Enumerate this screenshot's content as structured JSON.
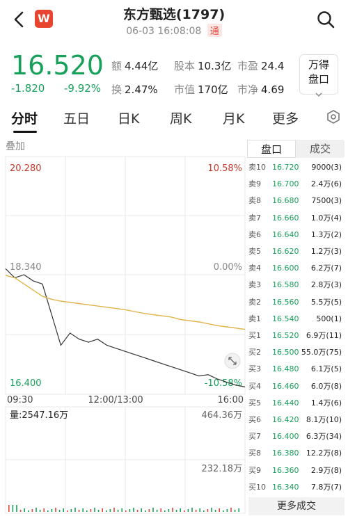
{
  "header": {
    "title": "东方甄选(1797)",
    "datetime": "06-03 16:08:08",
    "market_badge": "通",
    "logo_letter": "W"
  },
  "quote": {
    "price": "16.520",
    "change": "-1.820",
    "change_pct": "-9.92%",
    "stats": [
      {
        "k": "额",
        "v": "4.44亿"
      },
      {
        "k": "股本",
        "v": "10.3亿"
      },
      {
        "k": "市盈",
        "v": "24.4"
      },
      {
        "k": "换",
        "v": "2.47%"
      },
      {
        "k": "市值",
        "v": "170亿"
      },
      {
        "k": "市净",
        "v": "4.69"
      }
    ],
    "wan_label_1": "万得",
    "wan_label_2": "盘口"
  },
  "tabs": [
    "分时",
    "五日",
    "日K",
    "周K",
    "月K",
    "更多"
  ],
  "chart": {
    "overlay_label": "叠加",
    "high": "20.280",
    "high_pct": "10.58%",
    "mid": "18.340",
    "mid_pct": "0.00%",
    "low": "16.400",
    "low_pct": "-10.58%",
    "time_start": "09:30",
    "time_mid": "12:00/13:00",
    "time_end": "16:00",
    "volume_label": "量:2547.16万",
    "vol_max": "464.36万",
    "vol_mid": "232.18万",
    "colors": {
      "price_line": "#333333",
      "avg_line": "#e0b34a",
      "up": "#e4463a",
      "down": "#16a05a"
    }
  },
  "chart_data": {
    "type": "line",
    "title": "",
    "xlabel": "",
    "ylabel": "",
    "ylim": [
      16.4,
      20.28
    ],
    "x_ticks": [
      "09:30",
      "12:00/13:00",
      "16:00"
    ],
    "series": [
      {
        "values": [
          18.45,
          18.3,
          18.35,
          18.25,
          18.2,
          17.7,
          17.2,
          17.4,
          17.3,
          17.25,
          17.3,
          17.2,
          17.15,
          17.1,
          17.05,
          17.0,
          16.95,
          16.9,
          16.85,
          16.8,
          16.75,
          16.7,
          16.72,
          16.65,
          16.6,
          16.55,
          16.52
        ]
      },
      {
        "values": [
          18.34,
          18.3,
          18.2,
          18.1,
          18.0,
          17.95,
          17.92,
          17.9,
          17.88,
          17.86,
          17.84,
          17.82,
          17.8,
          17.78,
          17.75,
          17.72,
          17.7,
          17.68,
          17.66,
          17.62,
          17.6,
          17.58,
          17.55,
          17.52,
          17.5,
          17.48,
          17.46
        ]
      }
    ]
  },
  "order_book": {
    "tab_active": "盘口",
    "tab_other": "成交",
    "asks": [
      {
        "level": "卖10",
        "price": "16.720",
        "vol": "9000(3)"
      },
      {
        "level": "卖9",
        "price": "16.700",
        "vol": "2.4万(6)"
      },
      {
        "level": "卖8",
        "price": "16.680",
        "vol": "7500(3)"
      },
      {
        "level": "卖7",
        "price": "16.660",
        "vol": "1.0万(4)"
      },
      {
        "level": "卖6",
        "price": "16.640",
        "vol": "1.3万(2)"
      },
      {
        "level": "卖5",
        "price": "16.620",
        "vol": "1.2万(3)"
      },
      {
        "level": "卖4",
        "price": "16.600",
        "vol": "6.2万(7)"
      },
      {
        "level": "卖3",
        "price": "16.580",
        "vol": "2.8万(3)"
      },
      {
        "level": "卖2",
        "price": "16.560",
        "vol": "5.5万(5)"
      },
      {
        "level": "卖1",
        "price": "16.540",
        "vol": "500(1)"
      }
    ],
    "bids": [
      {
        "level": "买1",
        "price": "16.520",
        "vol": "6.9万(11)"
      },
      {
        "level": "买2",
        "price": "16.500",
        "vol": "55.0万(75)"
      },
      {
        "level": "买3",
        "price": "16.480",
        "vol": "6.1万(5)"
      },
      {
        "level": "买4",
        "price": "16.460",
        "vol": "6.0万(8)"
      },
      {
        "level": "买5",
        "price": "16.440",
        "vol": "1.4万(6)"
      },
      {
        "level": "买6",
        "price": "16.420",
        "vol": "8.1万(10)"
      },
      {
        "level": "买7",
        "price": "16.400",
        "vol": "6.3万(34)"
      },
      {
        "level": "买8",
        "price": "16.380",
        "vol": "12.2万(8)"
      },
      {
        "level": "买9",
        "price": "16.360",
        "vol": "2.9万(8)"
      },
      {
        "level": "买10",
        "price": "16.340",
        "vol": "7.8万(7)"
      }
    ],
    "more_label": "更多成交"
  }
}
